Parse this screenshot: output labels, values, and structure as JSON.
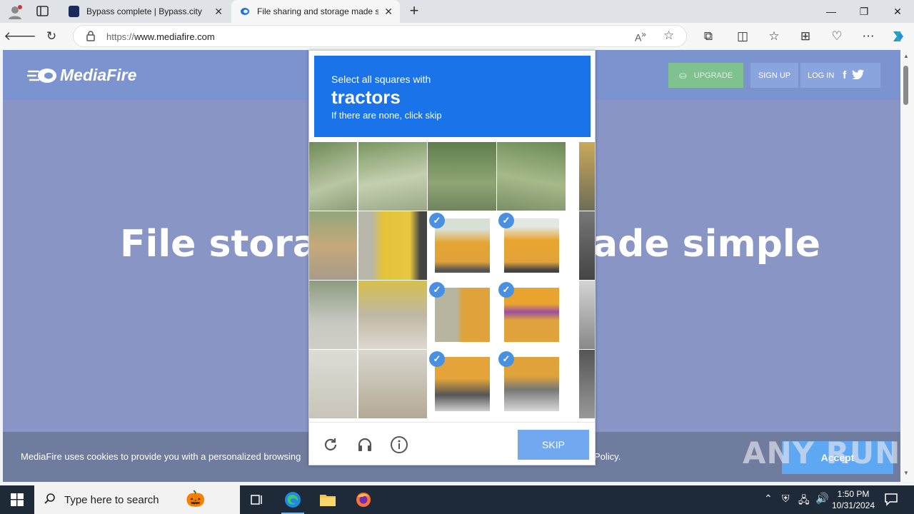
{
  "browser": {
    "tabs": [
      {
        "title": "Bypass complete | Bypass.city",
        "active": false
      },
      {
        "title": "File sharing and storage made simple",
        "active": true
      }
    ],
    "new_tab_label": "+",
    "url_proto": "https://",
    "url_host": "www.mediafire.com"
  },
  "site": {
    "logo": "MediaFire",
    "upgrade": "UPGRADE",
    "signup": "SIGN UP",
    "login": "LOG IN",
    "hero_left": "File storag",
    "hero_right": "ade simple",
    "cookie_text": "MediaFire uses cookies to provide you with a personalized browsing",
    "cookie_text_end": "Policy.",
    "accept": "Accept"
  },
  "captcha": {
    "instruction": "Select all squares with",
    "target": "tractors",
    "hint": "If there are none, click skip",
    "skip": "SKIP"
  },
  "watermark": "ANY RUN",
  "taskbar": {
    "search_placeholder": "Type here to search",
    "time": "1:50 PM",
    "date": "10/31/2024"
  },
  "colors": {
    "captcha_blue": "#1a73e8",
    "accent": "#5ea7f2"
  }
}
